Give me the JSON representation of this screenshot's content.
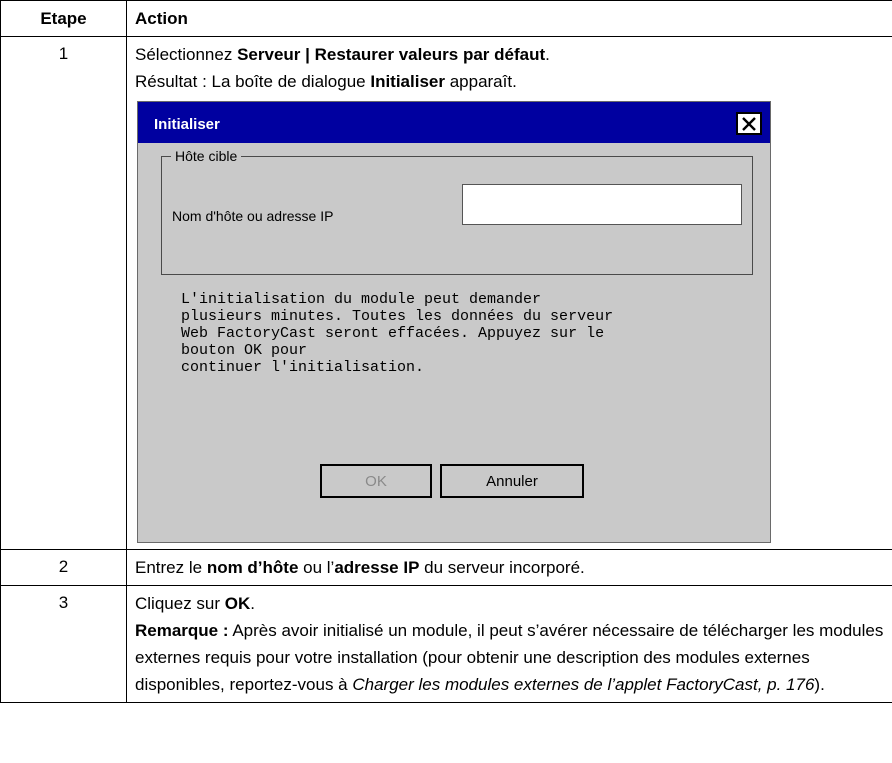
{
  "table": {
    "headers": [
      "Etape",
      "Action"
    ],
    "rows": [
      {
        "step": "1",
        "line1": {
          "pre": "Sélectionnez ",
          "b1": "Serveur",
          "sep": " | ",
          "b2": "Restaurer valeurs par défaut",
          "post": "."
        },
        "line2": {
          "pre": "Résultat : La boîte de dialogue ",
          "b": "Initialiser",
          "post": " apparaît."
        }
      },
      {
        "step": "2",
        "text": {
          "p1": "Entrez le ",
          "b1": "nom d’hôte",
          "p2": " ou l’",
          "b2": "adresse IP",
          "p3": " du serveur incorporé."
        }
      },
      {
        "step": "3",
        "line1": {
          "pre": "Cliquez sur ",
          "b": "OK",
          "post": "."
        },
        "note": {
          "label": "Remarque :",
          "text": " Après avoir initialisé un module, il peut s’avérer nécessaire de télécharger les modules externes requis pour votre installation (pour obtenir une description des modules externes disponibles, reportez-vous à ",
          "link": "Charger les modules externes de l’applet FactoryCast, p. 176",
          "end": ")."
        }
      }
    ]
  },
  "dialog": {
    "title": "Initialiser",
    "group_label": "Hôte cible",
    "field_label": "Nom d'hôte ou adresse IP",
    "field_value": "",
    "message_lines": [
      "L'initialisation du module peut demander",
      "plusieurs minutes. Toutes les données du serveur",
      "Web FactoryCast seront effacées. Appuyez sur le",
      "bouton OK pour",
      "continuer l'initialisation."
    ],
    "ok_label": "OK",
    "cancel_label": "Annuler"
  }
}
